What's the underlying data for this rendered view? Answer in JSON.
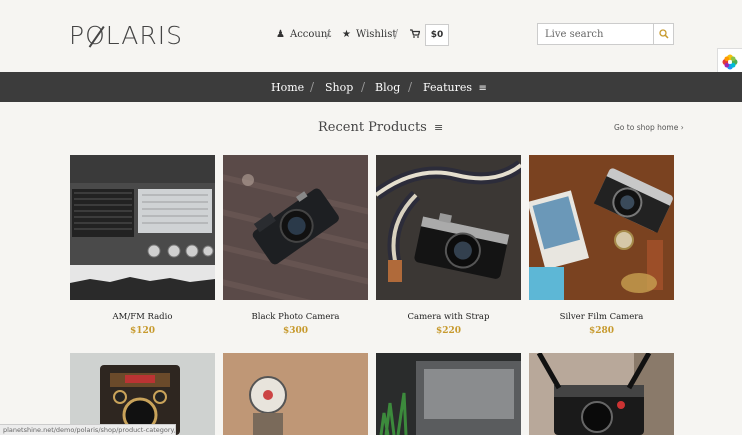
{
  "header": {
    "logo": "PØLARIS",
    "links": [
      {
        "label": "Account",
        "icon": "person-icon"
      },
      {
        "label": "Wishlist",
        "icon": "star-icon"
      }
    ],
    "cart_total": "$0",
    "search": {
      "placeholder": "Live search"
    }
  },
  "nav": {
    "items": [
      "Home",
      "Shop",
      "Blog",
      "Features"
    ],
    "separator": "/"
  },
  "section": {
    "title": "Recent Products",
    "shop_home_link": "Go to shop home"
  },
  "products": [
    {
      "name": "AM/FM Radio",
      "price": "$120"
    },
    {
      "name": "Black Photo Camera",
      "price": "$300"
    },
    {
      "name": "Camera with Strap",
      "price": "$220"
    },
    {
      "name": "Silver Film Camera",
      "price": "$280"
    }
  ],
  "status_url": "planetshine.net/demo/polaris/shop/product-category/...",
  "colors": {
    "price": "#c79a2e",
    "navbar": "#3c3c3c",
    "search_icon": "#c79a2e"
  }
}
